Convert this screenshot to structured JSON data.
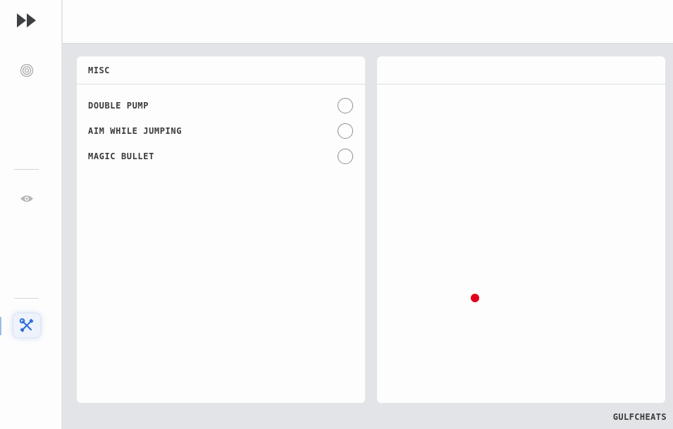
{
  "sidebar": {
    "items": [
      {
        "icon": "fast-forward-icon",
        "active": false
      },
      {
        "icon": "target-icon",
        "active": false
      },
      {
        "icon": "eye-icon",
        "active": false
      },
      {
        "icon": "tools-icon",
        "active": true
      }
    ]
  },
  "misc_panel": {
    "title": "MISC",
    "options": [
      {
        "label": "DOUBLE PUMP",
        "enabled": false
      },
      {
        "label": "AIM WHILE JUMPING",
        "enabled": false
      },
      {
        "label": "MAGIC BULLET",
        "enabled": false
      }
    ]
  },
  "preview_panel": {
    "title": "",
    "dot_color": "#e0001b"
  },
  "brand": "GULFCHEATS",
  "colors": {
    "accent": "#2f6fd6",
    "background": "#e2e4e7",
    "panel": "#fdfdfd",
    "dot": "#e0001b"
  }
}
